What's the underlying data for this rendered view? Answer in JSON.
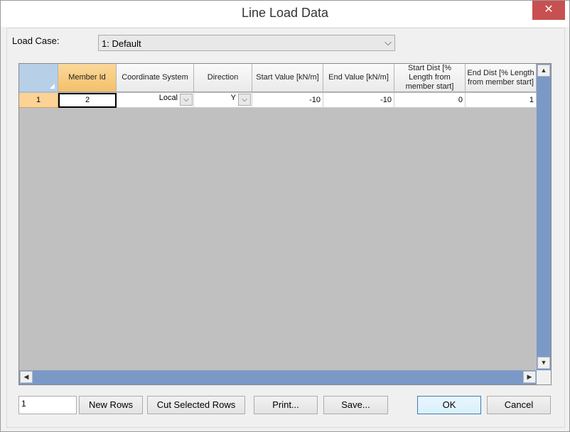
{
  "window": {
    "title": "Line Load Data",
    "close_glyph": "✕"
  },
  "load_case": {
    "label": "Load Case:",
    "selected": "1: Default",
    "arrow": "⌵"
  },
  "grid": {
    "columns": [
      "Member Id",
      "Coordinate System",
      "Direction",
      "Start Value [kN/m]",
      "End Value [kN/m]",
      "Start Dist [% Length from member start]",
      "End Dist [% Length from member start]"
    ],
    "rows": [
      {
        "row_label": "1",
        "member_id": "2",
        "coordinate_system": "Local",
        "direction": "Y",
        "start_value": "-10",
        "end_value": "-10",
        "start_dist": "0",
        "end_dist": "1"
      }
    ],
    "dropdown_glyph": "⌵",
    "scroll_up": "▲",
    "scroll_down": "▼",
    "scroll_left": "◀",
    "scroll_right": "▶"
  },
  "footer": {
    "row_count_value": "1",
    "new_rows_label": "New Rows",
    "cut_rows_label": "Cut Selected Rows",
    "print_label": "Print...",
    "save_label": "Save...",
    "ok_label": "OK",
    "cancel_label": "Cancel"
  }
}
